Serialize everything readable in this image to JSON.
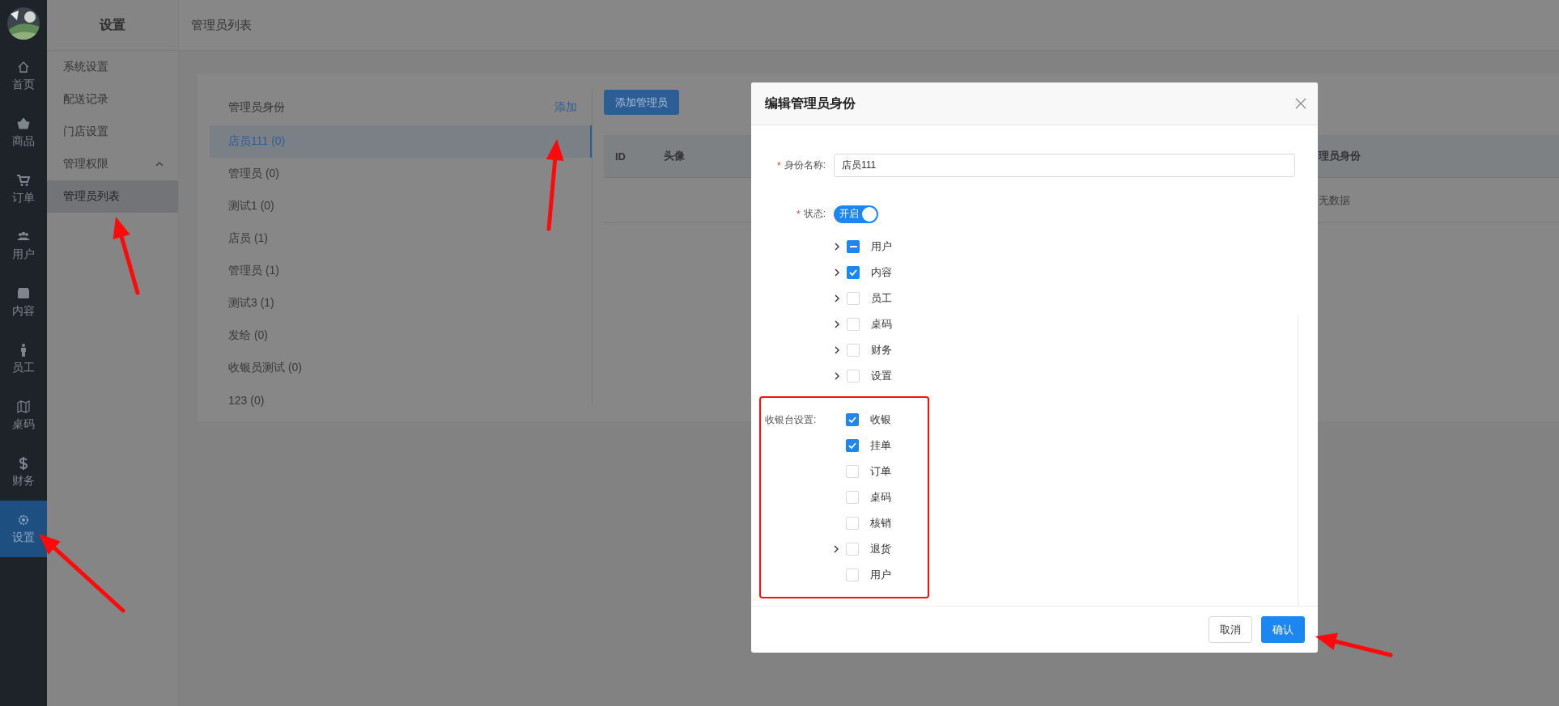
{
  "nav_rail": {
    "items": [
      {
        "label": "首页",
        "selected": false
      },
      {
        "label": "商品",
        "selected": false
      },
      {
        "label": "订单",
        "selected": false
      },
      {
        "label": "用户",
        "selected": false
      },
      {
        "label": "内容",
        "selected": false
      },
      {
        "label": "员工",
        "selected": false
      },
      {
        "label": "桌码",
        "selected": false
      },
      {
        "label": "财务",
        "selected": false
      },
      {
        "label": "设置",
        "selected": true
      }
    ]
  },
  "sub_sidebar": {
    "title": "设置",
    "items": [
      {
        "label": "系统设置",
        "selected": false
      },
      {
        "label": "配送记录",
        "selected": false
      },
      {
        "label": "门店设置",
        "selected": false
      },
      {
        "label": "管理权限",
        "expanded": true,
        "children": [
          {
            "label": "管理员列表",
            "selected": true
          }
        ]
      }
    ]
  },
  "header": {
    "title": "管理员列表"
  },
  "roles": {
    "title": "管理员身份",
    "add_link": "添加",
    "items": [
      {
        "label": "店员111 (0)",
        "selected": true
      },
      {
        "label": "管理员 (0)",
        "selected": false
      },
      {
        "label": "测试1 (0)",
        "selected": false
      },
      {
        "label": "店员 (1)",
        "selected": false
      },
      {
        "label": "管理员 (1)",
        "selected": false
      },
      {
        "label": "测试3 (1)",
        "selected": false
      },
      {
        "label": "发给 (0)",
        "selected": false
      },
      {
        "label": "收银员测试 (0)",
        "selected": false
      },
      {
        "label": "123 (0)",
        "selected": false
      }
    ]
  },
  "admins": {
    "add_button": "添加管理员",
    "columns": [
      "ID",
      "头像",
      "理员身份"
    ],
    "empty_text": "无数据"
  },
  "dialog": {
    "title": "编辑管理员身份",
    "name_required_mark": "*",
    "name_label": "身份名称:",
    "name_value": "店员111",
    "status_required_mark": "*",
    "status_label": "状态:",
    "status_on": true,
    "status_text": "开启",
    "tree": [
      {
        "label": "用户",
        "expandable": true,
        "checked": false,
        "indeterminate": true
      },
      {
        "label": "内容",
        "expandable": true,
        "checked": true,
        "indeterminate": false
      },
      {
        "label": "员工",
        "expandable": true,
        "checked": false,
        "indeterminate": false
      },
      {
        "label": "桌码",
        "expandable": true,
        "checked": false,
        "indeterminate": false
      },
      {
        "label": "财务",
        "expandable": true,
        "checked": false,
        "indeterminate": false
      },
      {
        "label": "设置",
        "expandable": true,
        "checked": false,
        "indeterminate": false
      }
    ],
    "cashier": {
      "label": "收银台设置:",
      "items": [
        {
          "label": "收银",
          "expandable": false,
          "checked": true,
          "indeterminate": false
        },
        {
          "label": "挂单",
          "expandable": false,
          "checked": true,
          "indeterminate": false
        },
        {
          "label": "订单",
          "expandable": false,
          "checked": false,
          "indeterminate": false
        },
        {
          "label": "桌码",
          "expandable": false,
          "checked": false,
          "indeterminate": false
        },
        {
          "label": "核销",
          "expandable": false,
          "checked": false,
          "indeterminate": false
        },
        {
          "label": "退货",
          "expandable": true,
          "checked": false,
          "indeterminate": false
        },
        {
          "label": "用户",
          "expandable": false,
          "checked": false,
          "indeterminate": false
        }
      ]
    },
    "cancel_button": "取消",
    "confirm_button": "确认"
  }
}
